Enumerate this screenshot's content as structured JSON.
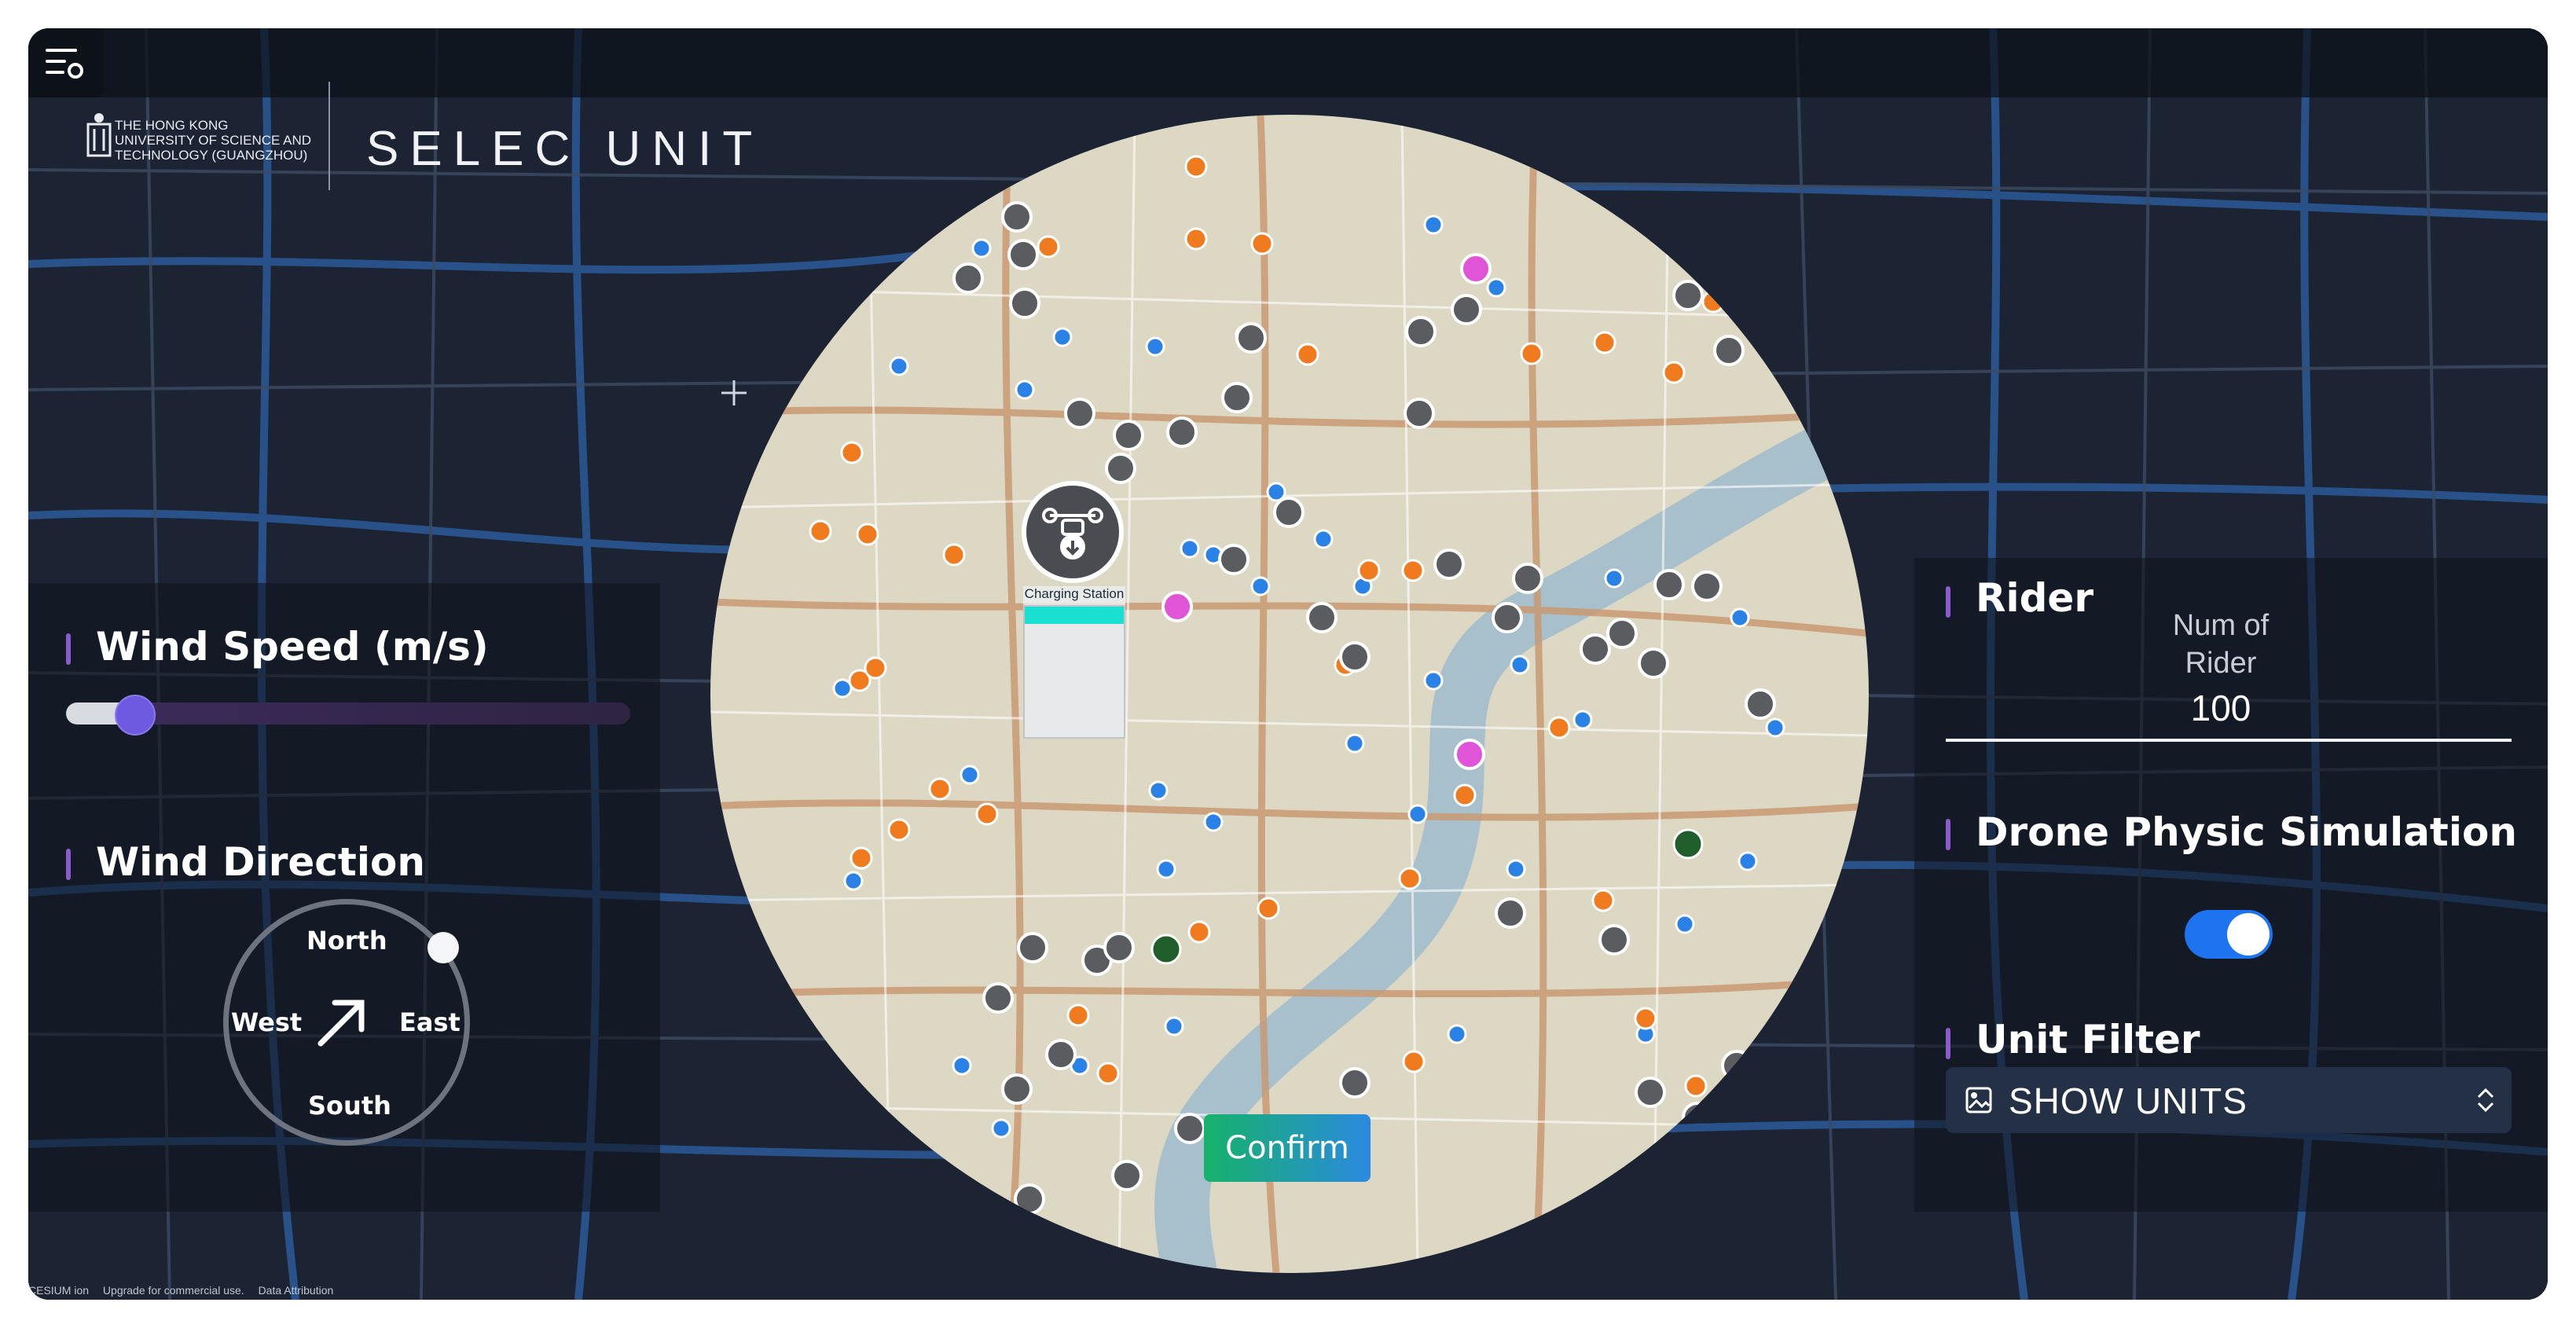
{
  "header": {
    "logo_lines": [
      "THE HONG KONG",
      "UNIVERSITY OF SCIENCE AND",
      "TECHNOLOGY (GUANGZHOU)"
    ],
    "app_title": "SELEC UNIT"
  },
  "left_panel": {
    "wind_speed": {
      "title": "Wind Speed (m/s)",
      "slider_fraction": 0.13
    },
    "wind_direction": {
      "title": "Wind Direction",
      "labels": {
        "north": "North",
        "south": "South",
        "east": "East",
        "west": "West"
      },
      "arrow_heading": "north-east"
    }
  },
  "map_popup": {
    "label": "Charging Station"
  },
  "confirm_label": "Confirm",
  "right_panel": {
    "rider": {
      "title": "Rider",
      "num_label_line1": "Num of",
      "num_label_line2": "Rider",
      "num_value": "100"
    },
    "drone": {
      "title": "Drone Physic Simulation",
      "toggle_on": true
    },
    "unit_filter": {
      "title": "Unit Filter",
      "select_value": "SHOW UNITS"
    }
  },
  "footer": {
    "brand": "CESIUM ion",
    "upgrade": "Upgrade for commercial use.",
    "attribution": "Data Attribution"
  },
  "colors": {
    "accent_purple": "#8a5cc9",
    "toggle_blue": "#1e73f0",
    "confirm_gradient_start": "#16b26a",
    "confirm_gradient_end": "#2b8ae0",
    "marker_orange": "#f07a1e",
    "marker_blue": "#2a82e6",
    "marker_gray": "#5a5c60",
    "marker_pink": "#e055d8",
    "marker_green": "#1f5e2a"
  }
}
